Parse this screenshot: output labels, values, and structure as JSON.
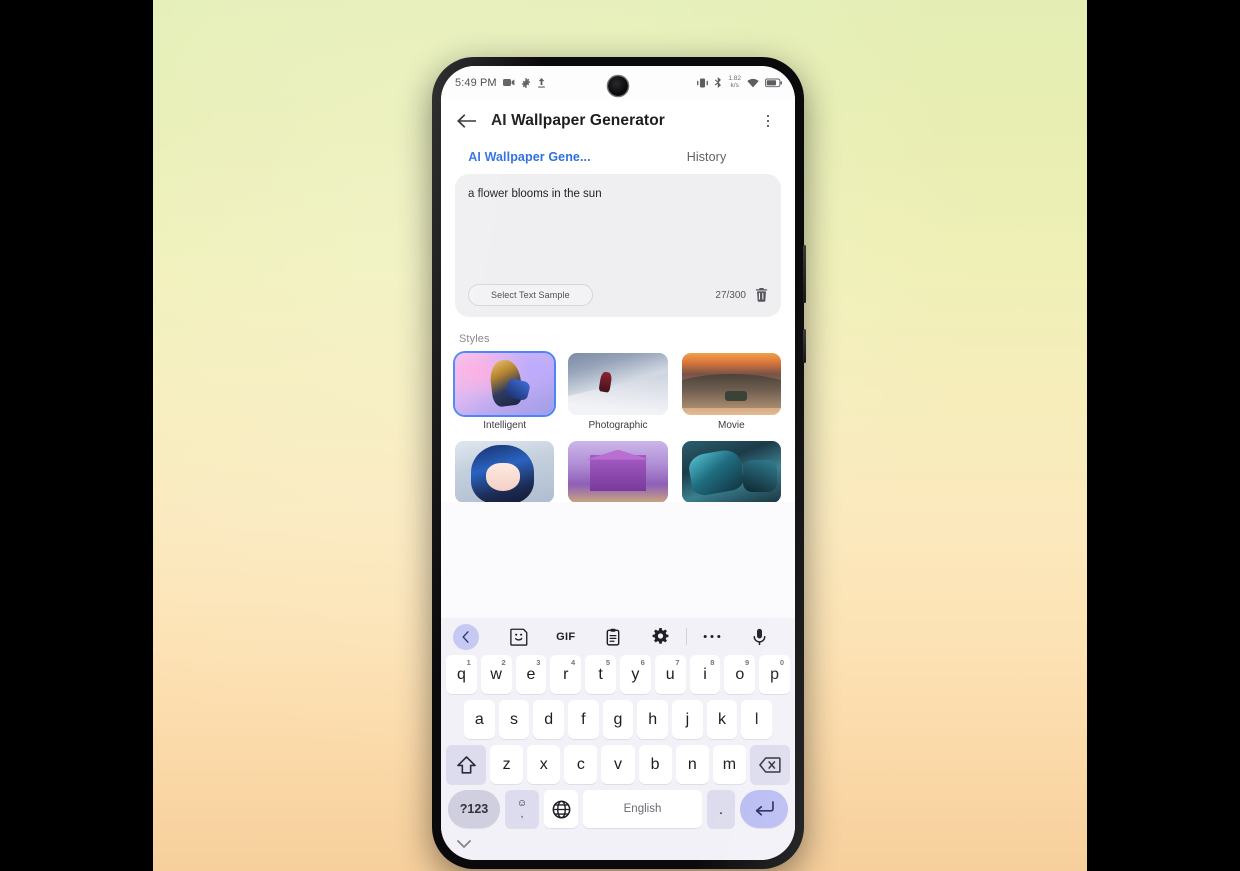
{
  "status_bar": {
    "time": "5:49 PM",
    "left_icons": [
      "video-icon",
      "gear-icon",
      "upload-icon"
    ],
    "data_rate_value": "1.82",
    "data_rate_unit": "k/s",
    "right_icons": [
      "vibrate-icon",
      "bluetooth-icon",
      "wifi-icon",
      "battery-icon"
    ]
  },
  "app_bar": {
    "back_icon": "back-arrow-icon",
    "title": "AI Wallpaper Generator",
    "menu_icon": "kebab-menu-icon"
  },
  "tabs": [
    {
      "label": "AI Wallpaper Gene...",
      "active": true
    },
    {
      "label": "History",
      "active": false
    }
  ],
  "prompt": {
    "text": "a flower blooms in the sun",
    "sample_button_label": "Select Text Sample",
    "counter": "27/300",
    "counter_current": 27,
    "counter_max": 300,
    "clear_icon": "trash-icon"
  },
  "styles": {
    "section_label": "Styles",
    "items": [
      {
        "name": "Intelligent",
        "selected": true,
        "art": "a-intel"
      },
      {
        "name": "Photographic",
        "selected": false,
        "art": "a-photo"
      },
      {
        "name": "Movie",
        "selected": false,
        "art": "a-movie"
      },
      {
        "name": "",
        "selected": false,
        "art": "a-anime"
      },
      {
        "name": "",
        "selected": false,
        "art": "a-temple"
      },
      {
        "name": "",
        "selected": false,
        "art": "a-mech"
      }
    ]
  },
  "keyboard": {
    "toolbar": [
      {
        "icon": "back-chevron-icon",
        "label": ""
      },
      {
        "icon": "sticker-icon",
        "label": ""
      },
      {
        "icon": "gif-icon",
        "label": "GIF"
      },
      {
        "icon": "clipboard-icon",
        "label": ""
      },
      {
        "icon": "settings-gear-icon",
        "label": ""
      },
      {
        "icon": "more-dots-icon",
        "label": ""
      },
      {
        "icon": "microphone-icon",
        "label": ""
      }
    ],
    "row1": [
      {
        "key": "q",
        "num": "1"
      },
      {
        "key": "w",
        "num": "2"
      },
      {
        "key": "e",
        "num": "3"
      },
      {
        "key": "r",
        "num": "4"
      },
      {
        "key": "t",
        "num": "5"
      },
      {
        "key": "y",
        "num": "6"
      },
      {
        "key": "u",
        "num": "7"
      },
      {
        "key": "i",
        "num": "8"
      },
      {
        "key": "o",
        "num": "9"
      },
      {
        "key": "p",
        "num": "0"
      }
    ],
    "row2": [
      "a",
      "s",
      "d",
      "f",
      "g",
      "h",
      "j",
      "k",
      "l"
    ],
    "row3": [
      "z",
      "x",
      "c",
      "v",
      "b",
      "n",
      "m"
    ],
    "shift_icon": "shift-up-icon",
    "backspace_icon": "backspace-icon",
    "numbers_key": "?123",
    "emoji_key_top": "☺",
    "emoji_key_bottom": ",",
    "globe_icon": "globe-language-icon",
    "space_label": "English",
    "period_key": ".",
    "enter_icon": "enter-return-icon",
    "collapse_icon": "chevron-down-icon"
  },
  "colors": {
    "accent_blue": "#2f6fe4",
    "selection_border": "#4a86f7",
    "key_bg": "#ffffff",
    "keyboard_bg": "#f2f1f8",
    "mod_key_bg": "#dcdcee",
    "enter_key_bg": "#b9bcf2"
  }
}
